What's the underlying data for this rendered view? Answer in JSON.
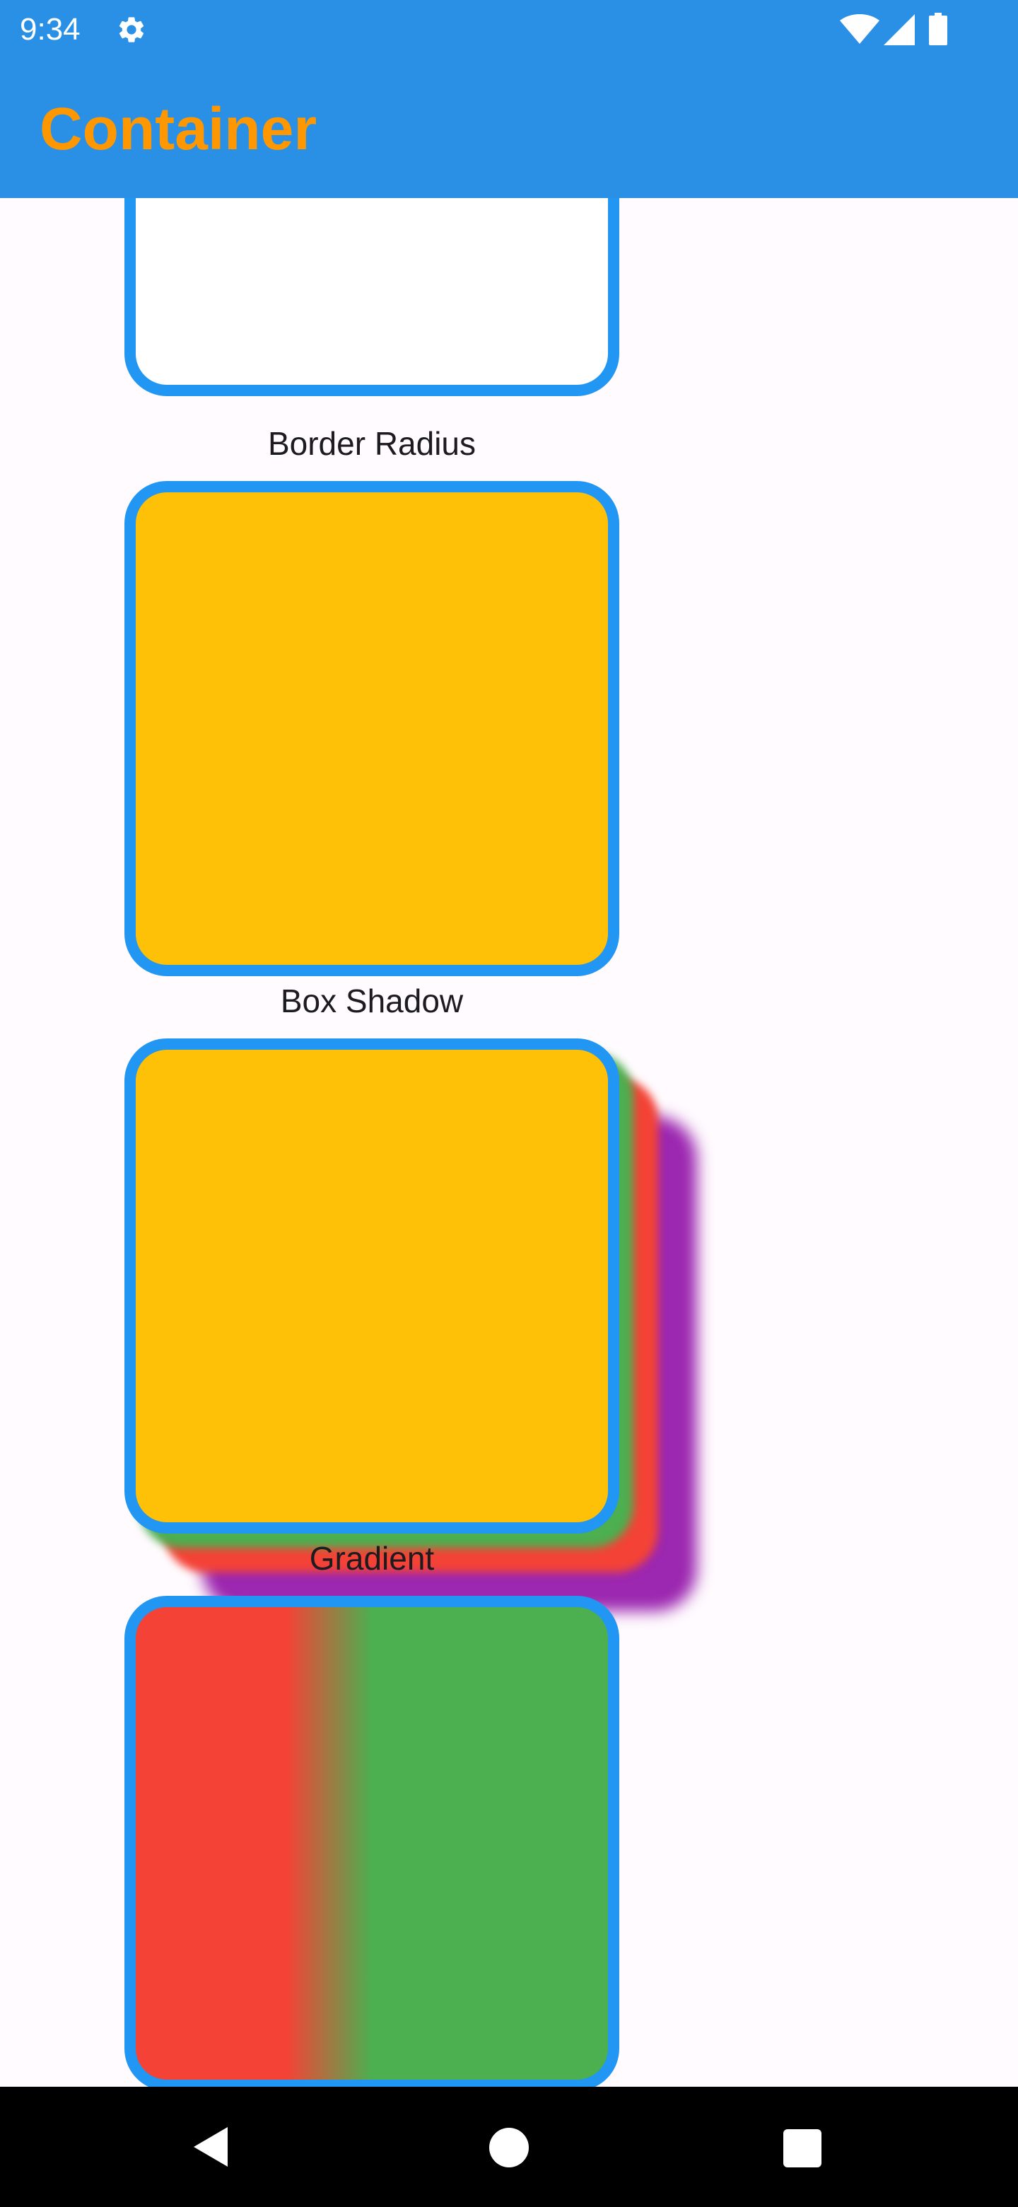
{
  "status_bar": {
    "time": "9:34",
    "icons": [
      "gear-icon",
      "wifi-icon",
      "signal-icon",
      "battery-icon"
    ]
  },
  "app_bar": {
    "title": "Container"
  },
  "sections": [
    {
      "caption": "Border Radius"
    },
    {
      "caption": "Box Shadow"
    },
    {
      "caption": "Gradient"
    }
  ],
  "nav_bar": {
    "icons": [
      "back-icon",
      "home-icon",
      "recents-icon"
    ]
  },
  "colors": {
    "primary": "#2a90e6",
    "title": "#ff9800",
    "box_border": "#2196f3",
    "amber": "#ffc107",
    "green": "#4caf50",
    "red": "#f44336",
    "purple": "#9c27b0",
    "background": "#fffbfe"
  }
}
